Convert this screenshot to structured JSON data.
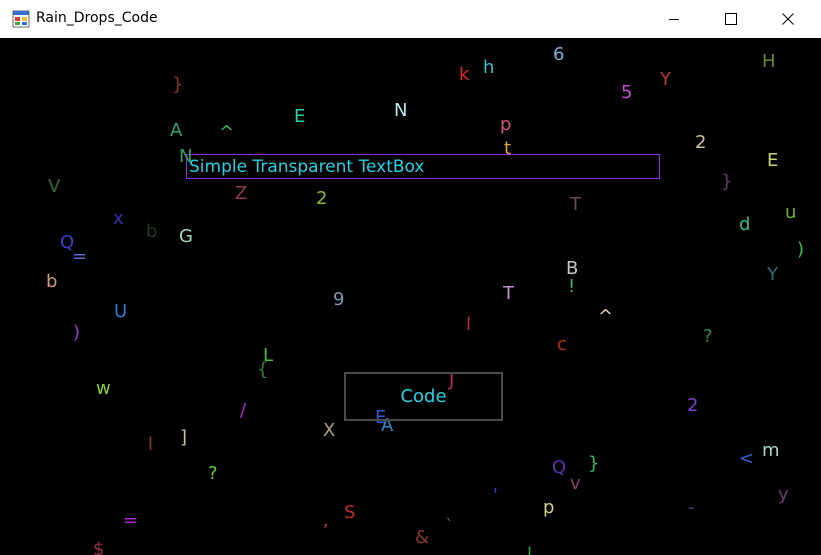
{
  "window": {
    "title": "Rain_Drops_Code",
    "icon": "winforms-app-icon",
    "controls": {
      "minimize": "minimize-icon",
      "maximize": "maximize-icon",
      "close": "close-icon"
    }
  },
  "textbox": {
    "value": "Simple Transparent TextBox"
  },
  "code_button": {
    "label": "Code"
  },
  "drops": [
    {
      "ch": "}",
      "color": "#8b3a1f"
    },
    {
      "ch": "k",
      "color": "#e02a2a"
    },
    {
      "ch": "h",
      "color": "#35c3c9"
    },
    {
      "ch": "6",
      "color": "#7fb3d9"
    },
    {
      "ch": "5",
      "color": "#c04fd1"
    },
    {
      "ch": "Y",
      "color": "#b53838"
    },
    {
      "ch": "H",
      "color": "#5f8a3a"
    },
    {
      "ch": "A",
      "color": "#2fa36a"
    },
    {
      "ch": "^",
      "color": "#3fbf63"
    },
    {
      "ch": "E",
      "color": "#2bd1a8"
    },
    {
      "ch": "N",
      "color": "#bfe7ee"
    },
    {
      "ch": "p",
      "color": "#d4587d"
    },
    {
      "ch": "t",
      "color": "#e0a22a"
    },
    {
      "ch": "2",
      "color": "#d0c3a0"
    },
    {
      "ch": "N",
      "color": "#2fa36a"
    },
    {
      "ch": "E",
      "color": "#c9d66c"
    },
    {
      "ch": "V",
      "color": "#2e6e2e"
    },
    {
      "ch": "}",
      "color": "#6a3f6e"
    },
    {
      "ch": "Z",
      "color": "#8b3a4e"
    },
    {
      "ch": "2",
      "color": "#8ab83a"
    },
    {
      "ch": "T",
      "color": "#6b4d4d"
    },
    {
      "ch": "u",
      "color": "#6ab52a"
    },
    {
      "ch": "x",
      "color": "#3b2fb0"
    },
    {
      "ch": "b",
      "color": "#1f3a1f"
    },
    {
      "ch": "G",
      "color": "#a8d8b8"
    },
    {
      "ch": "d",
      "color": "#2fbf8a"
    },
    {
      "ch": "Q",
      "color": "#3b3fd0"
    },
    {
      "ch": "=",
      "color": "#5a6ad0"
    },
    {
      "ch": ")",
      "color": "#3fbf3f"
    },
    {
      "ch": "b",
      "color": "#d09a7a"
    },
    {
      "ch": "B",
      "color": "#c8c8c8"
    },
    {
      "ch": "Y",
      "color": "#2b6e7a"
    },
    {
      "ch": "!",
      "color": "#2fbf63"
    },
    {
      "ch": "9",
      "color": "#7a9ab0"
    },
    {
      "ch": "T",
      "color": "#c98fd8"
    },
    {
      "ch": "U",
      "color": "#2f7ad0"
    },
    {
      "ch": "^",
      "color": "#e8d8c0"
    },
    {
      "ch": ")",
      "color": "#8b3fd0"
    },
    {
      "ch": "l",
      "color": "#c02a2a"
    },
    {
      "ch": "c",
      "color": "#c02a2a"
    },
    {
      "ch": "?",
      "color": "#2f8a4a"
    },
    {
      "ch": "L",
      "color": "#3fbf3f"
    },
    {
      "ch": "{",
      "color": "#3f7a3f"
    },
    {
      "ch": "J",
      "color": "#c02a5a"
    },
    {
      "ch": "w",
      "color": "#8ad02a"
    },
    {
      "ch": "/",
      "color": "#b02ad0"
    },
    {
      "ch": "2",
      "color": "#7a3fd0"
    },
    {
      "ch": "l",
      "color": "#8b3a1f"
    },
    {
      "ch": "]",
      "color": "#d0c0a0"
    },
    {
      "ch": "X",
      "color": "#b0a07a"
    },
    {
      "ch": "E",
      "color": "#2f5ad0"
    },
    {
      "ch": "A",
      "color": "#2f8ad0"
    },
    {
      "ch": "<",
      "color": "#3f5ad0"
    },
    {
      "ch": "m",
      "color": "#a8d8c8"
    },
    {
      "ch": "?",
      "color": "#6ad02a"
    },
    {
      "ch": "Q",
      "color": "#5a2fb0"
    },
    {
      "ch": "v",
      "color": "#8b3a6e"
    },
    {
      "ch": "}",
      "color": "#2fbf63"
    },
    {
      "ch": "y",
      "color": "#6a3f6e"
    },
    {
      "ch": "=",
      "color": "#b02ad0"
    },
    {
      "ch": ",",
      "color": "#c02a2a"
    },
    {
      "ch": "S",
      "color": "#c02a2a"
    },
    {
      "ch": "'",
      "color": "#2f3ad0"
    },
    {
      "ch": "p",
      "color": "#d0d08a"
    },
    {
      "ch": "-",
      "color": "#3f3f6e"
    },
    {
      "ch": "$",
      "color": "#a02a4a"
    },
    {
      "ch": "&",
      "color": "#8b3a1f"
    },
    {
      "ch": "`",
      "color": "#7a5a3a"
    },
    {
      "ch": "l",
      "color": "#2fa33a"
    }
  ]
}
